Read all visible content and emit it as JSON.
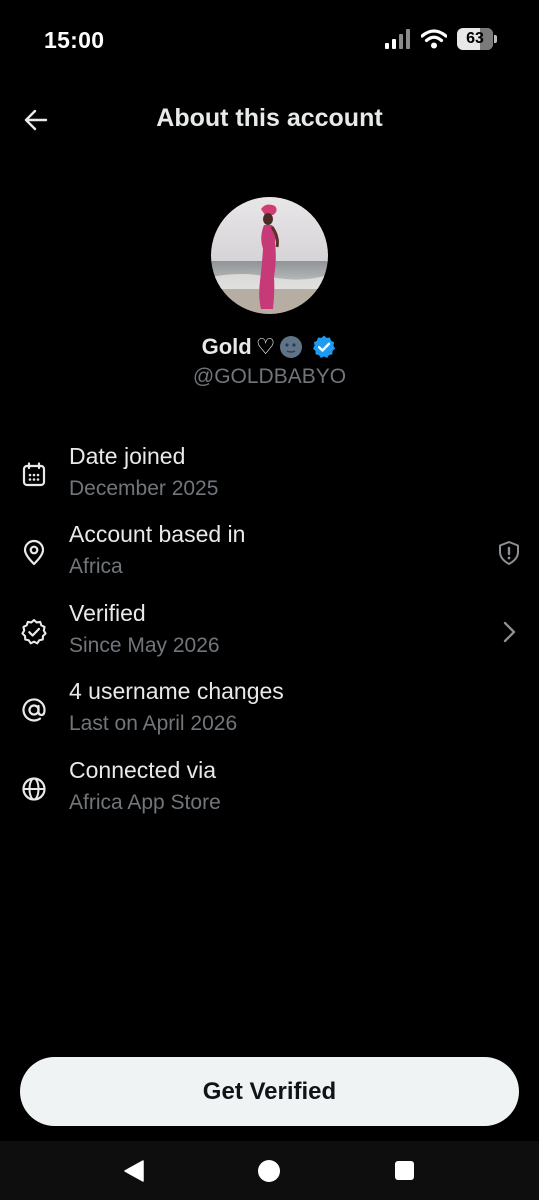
{
  "status_bar": {
    "time": "15:00",
    "battery_level": "63",
    "battery_fraction": 0.63,
    "icons": [
      "signal-icon",
      "wifi-icon",
      "battery-icon"
    ]
  },
  "header": {
    "title": "About this account",
    "back_icon": "arrow-left-icon"
  },
  "profile": {
    "display_name": "Gold",
    "name_emojis": [
      "white-heart",
      "new-moon-face"
    ],
    "verified_badge": "verified-badge-icon",
    "username": "@GOLDBABYO"
  },
  "details": [
    {
      "icon": "calendar-icon",
      "label": "Date joined",
      "value": "December 2025",
      "trailing": null
    },
    {
      "icon": "location-pin-icon",
      "label": "Account based in",
      "value": "Africa",
      "trailing": "shield-alert-icon"
    },
    {
      "icon": "verified-outline-icon",
      "label": "Verified",
      "value": "Since May 2026",
      "trailing": "chevron-right-icon"
    },
    {
      "icon": "at-sign-icon",
      "label": "4 username changes",
      "value": "Last on April 2026",
      "trailing": null
    },
    {
      "icon": "globe-icon",
      "label": "Connected via",
      "value": "Africa App Store",
      "trailing": null
    }
  ],
  "cta": {
    "label": "Get Verified"
  },
  "nav_bar": {
    "icons": [
      "nav-back-icon",
      "nav-home-icon",
      "nav-recents-icon"
    ]
  },
  "colors": {
    "background": "#000000",
    "primary_text": "#e7e9ea",
    "secondary_text": "#71767b",
    "verified_blue": "#1d9bf0",
    "button_bg": "#eff3f4",
    "button_text": "#0f1419"
  }
}
